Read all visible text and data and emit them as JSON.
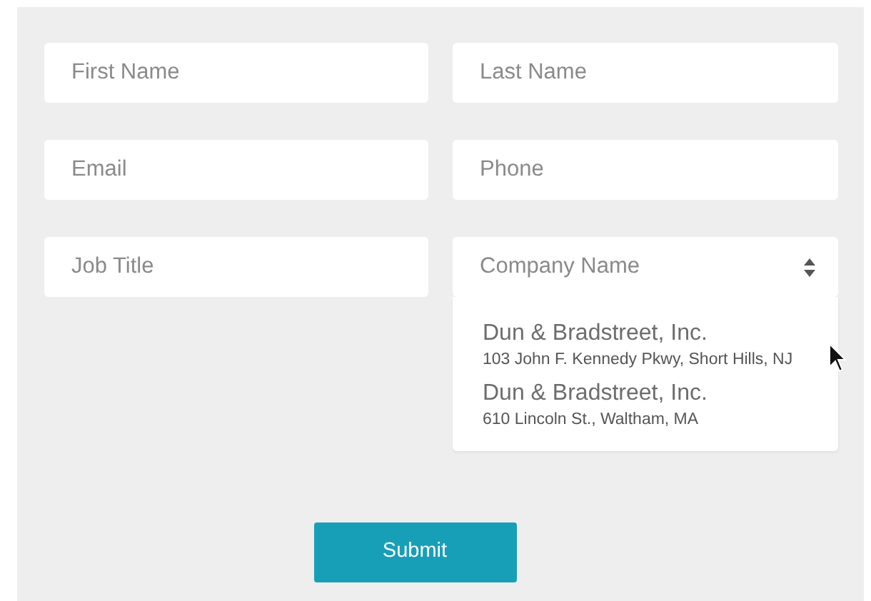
{
  "fields": [
    {
      "placeholder": "First Name"
    },
    {
      "placeholder": "Last Name"
    },
    {
      "placeholder": "Email"
    },
    {
      "placeholder": "Phone"
    },
    {
      "placeholder": "Job Title"
    },
    {
      "placeholder": "Company Name",
      "kind": "select"
    }
  ],
  "suggestions": [
    {
      "name": "Dun & Bradstreet, Inc.",
      "address": "103 John F. Kennedy Pkwy, Short Hills, NJ"
    },
    {
      "name": "Dun & Bradstreet, Inc.",
      "address": "610 Lincoln St., Waltham, MA"
    }
  ],
  "submit": "Submit"
}
